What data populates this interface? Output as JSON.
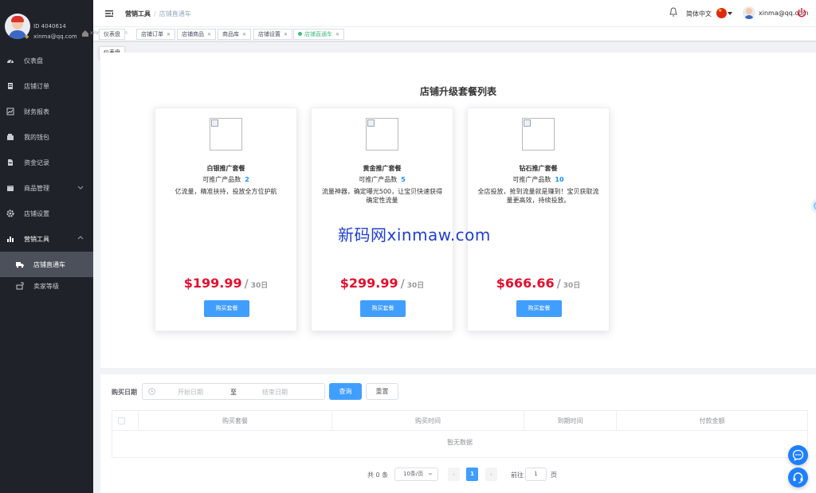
{
  "user": {
    "id_text": "ID 4040614",
    "email": "xinma@qq.com"
  },
  "sidebar": {
    "items": [
      {
        "label": "仪表盘",
        "icon": "dashboard-icon"
      },
      {
        "label": "店铺订单",
        "icon": "clipboard-icon"
      },
      {
        "label": "财务报表",
        "icon": "chart-icon"
      },
      {
        "label": "我的钱包",
        "icon": "wallet-icon"
      },
      {
        "label": "资金记录",
        "icon": "document-icon"
      },
      {
        "label": "商品管理",
        "icon": "box-icon"
      },
      {
        "label": "店铺设置",
        "icon": "gear-icon"
      },
      {
        "label": "营销工具",
        "icon": "bar-chart-icon"
      },
      {
        "label": "店铺直通车",
        "icon": "truck-icon"
      },
      {
        "label": "卖家等级",
        "icon": "level-icon"
      }
    ]
  },
  "header": {
    "breadcrumb": [
      "营销工具",
      "店铺直通车"
    ],
    "language": "简体中文",
    "user_email": "xinma@qq.com"
  },
  "tags": {
    "items": [
      "仪表盘",
      "店铺订单",
      "店铺商品",
      "商品库",
      "店铺设置",
      "店铺直通车"
    ],
    "tooltip": "仪表盘",
    "ghost_text": "xinma@qq.com"
  },
  "plans": {
    "title": "店铺升级套餐列表",
    "count_label": "可推广产品数",
    "period": "30日",
    "buy_label": "购买套餐",
    "items": [
      {
        "name": "白银推广套餐",
        "count": "2",
        "desc": "亿流量，精准扶持，投放全方位护航",
        "price": "$199.99"
      },
      {
        "name": "黄金推广套餐",
        "count": "5",
        "desc": "流量神器，确定曝光500，让宝贝快速获得确定性流量",
        "price": "$299.99"
      },
      {
        "name": "钻石推广套餐",
        "count": "10",
        "desc": "全店投放，抢到流量就是赚到！宝贝获取流量更高效，持续投放。",
        "price": "$666.66"
      }
    ]
  },
  "watermark": "新码网xinmaw.com",
  "filter": {
    "label": "购买日期",
    "start_placeholder": "开始日期",
    "separator": "至",
    "end_placeholder": "结束日期",
    "search_label": "查询",
    "reset_label": "重置"
  },
  "table": {
    "columns": [
      "购买套餐",
      "购买时间",
      "到期时间",
      "付款金额"
    ],
    "empty_text": "暂无数据"
  },
  "pagination": {
    "total": "共 0 条",
    "page_size": "10条/页",
    "current_page": "1",
    "goto_label": "前往",
    "goto_value": "1",
    "page_unit": "页"
  },
  "colors": {
    "sidebar_bg": "#1f2329",
    "primary": "#409eff",
    "price_red": "#e4102f",
    "active_tag": "#42b983"
  }
}
